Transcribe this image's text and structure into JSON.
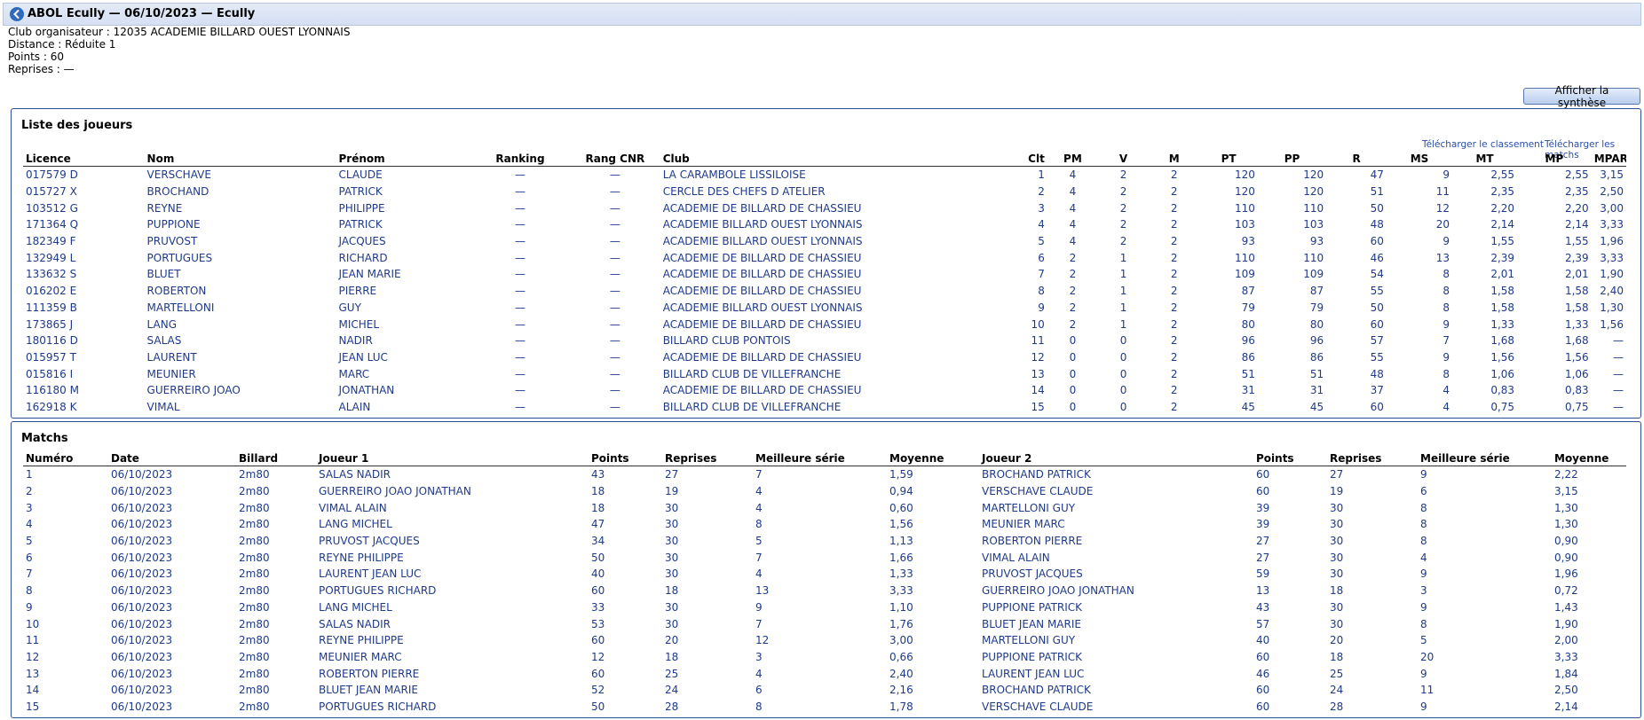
{
  "header": {
    "title": "ABOL Ecully — 06/10/2023 — Ecully",
    "back_icon": "arrow-left-circle-icon"
  },
  "info": {
    "club": "Club organisateur : 12035 ACADEMIE BILLARD OUEST LYONNAIS",
    "distance": "Distance : Réduite 1",
    "points": "Points : 60",
    "reprises": "Reprises : —"
  },
  "buttons": {
    "synthese": "Afficher la synthèse"
  },
  "players": {
    "title": "Liste des joueurs",
    "download_ranking": "Télécharger le classement",
    "download_matches": "Télécharger les matchs",
    "columns": [
      "Licence",
      "Nom",
      "Prénom",
      "Ranking",
      "Rang CNR",
      "Club",
      "Clt",
      "PM",
      "V",
      "M",
      "PT",
      "PP",
      "R",
      "MS",
      "MT",
      "MP",
      "MPART"
    ],
    "rows": [
      [
        "017579 D",
        "VERSCHAVE",
        "CLAUDE",
        "—",
        "—",
        "LA CARAMBOLE LISSILOISE",
        "1",
        "4",
        "2",
        "2",
        "120",
        "120",
        "47",
        "9",
        "2,55",
        "2,55",
        "3,15"
      ],
      [
        "015727 X",
        "BROCHAND",
        "PATRICK",
        "—",
        "—",
        "CERCLE DES CHEFS D ATELIER",
        "2",
        "4",
        "2",
        "2",
        "120",
        "120",
        "51",
        "11",
        "2,35",
        "2,35",
        "2,50"
      ],
      [
        "103512 G",
        "REYNE",
        "PHILIPPE",
        "—",
        "—",
        "ACADEMIE DE BILLARD DE CHASSIEU",
        "3",
        "4",
        "2",
        "2",
        "110",
        "110",
        "50",
        "12",
        "2,20",
        "2,20",
        "3,00"
      ],
      [
        "171364 Q",
        "PUPPIONE",
        "PATRICK",
        "—",
        "—",
        "ACADEMIE BILLARD OUEST LYONNAIS",
        "4",
        "4",
        "2",
        "2",
        "103",
        "103",
        "48",
        "20",
        "2,14",
        "2,14",
        "3,33"
      ],
      [
        "182349 F",
        "PRUVOST",
        "JACQUES",
        "—",
        "—",
        "ACADEMIE BILLARD OUEST LYONNAIS",
        "5",
        "4",
        "2",
        "2",
        "93",
        "93",
        "60",
        "9",
        "1,55",
        "1,55",
        "1,96"
      ],
      [
        "132949 L",
        "PORTUGUES",
        "RICHARD",
        "—",
        "—",
        "ACADEMIE DE BILLARD DE CHASSIEU",
        "6",
        "2",
        "1",
        "2",
        "110",
        "110",
        "46",
        "13",
        "2,39",
        "2,39",
        "3,33"
      ],
      [
        "133632 S",
        "BLUET",
        "JEAN MARIE",
        "—",
        "—",
        "ACADEMIE DE BILLARD DE CHASSIEU",
        "7",
        "2",
        "1",
        "2",
        "109",
        "109",
        "54",
        "8",
        "2,01",
        "2,01",
        "1,90"
      ],
      [
        "016202 E",
        "ROBERTON",
        "PIERRE",
        "—",
        "—",
        "ACADEMIE DE BILLARD DE CHASSIEU",
        "8",
        "2",
        "1",
        "2",
        "87",
        "87",
        "55",
        "8",
        "1,58",
        "1,58",
        "2,40"
      ],
      [
        "111359 B",
        "MARTELLONI",
        "GUY",
        "—",
        "—",
        "ACADEMIE BILLARD OUEST LYONNAIS",
        "9",
        "2",
        "1",
        "2",
        "79",
        "79",
        "50",
        "8",
        "1,58",
        "1,58",
        "1,30"
      ],
      [
        "173865 J",
        "LANG",
        "MICHEL",
        "—",
        "—",
        "ACADEMIE DE BILLARD DE CHASSIEU",
        "10",
        "2",
        "1",
        "2",
        "80",
        "80",
        "60",
        "9",
        "1,33",
        "1,33",
        "1,56"
      ],
      [
        "180116 D",
        "SALAS",
        "NADIR",
        "—",
        "—",
        "BILLARD CLUB PONTOIS",
        "11",
        "0",
        "0",
        "2",
        "96",
        "96",
        "57",
        "7",
        "1,68",
        "1,68",
        "—"
      ],
      [
        "015957 T",
        "LAURENT",
        "JEAN LUC",
        "—",
        "—",
        "ACADEMIE DE BILLARD DE CHASSIEU",
        "12",
        "0",
        "0",
        "2",
        "86",
        "86",
        "55",
        "9",
        "1,56",
        "1,56",
        "—"
      ],
      [
        "015816 I",
        "MEUNIER",
        "MARC",
        "—",
        "—",
        "BILLARD CLUB DE VILLEFRANCHE",
        "13",
        "0",
        "0",
        "2",
        "51",
        "51",
        "48",
        "8",
        "1,06",
        "1,06",
        "—"
      ],
      [
        "116180 M",
        "GUERREIRO JOAO",
        "JONATHAN",
        "—",
        "—",
        "ACADEMIE DE BILLARD DE CHASSIEU",
        "14",
        "0",
        "0",
        "2",
        "31",
        "31",
        "37",
        "4",
        "0,83",
        "0,83",
        "—"
      ],
      [
        "162918 K",
        "VIMAL",
        "ALAIN",
        "—",
        "—",
        "BILLARD CLUB DE VILLEFRANCHE",
        "15",
        "0",
        "0",
        "2",
        "45",
        "45",
        "60",
        "4",
        "0,75",
        "0,75",
        "—"
      ]
    ]
  },
  "matches": {
    "title": "Matchs",
    "columns": [
      "Numéro",
      "Date",
      "Billard",
      "Joueur 1",
      "Points",
      "Reprises",
      "Meilleure série",
      "Moyenne",
      "Joueur 2",
      "Points",
      "Reprises",
      "Meilleure série",
      "Moyenne"
    ],
    "rows": [
      [
        "1",
        "06/10/2023",
        "2m80",
        "SALAS NADIR",
        "43",
        "27",
        "7",
        "1,59",
        "BROCHAND PATRICK",
        "60",
        "27",
        "9",
        "2,22"
      ],
      [
        "2",
        "06/10/2023",
        "2m80",
        "GUERREIRO JOAO JONATHAN",
        "18",
        "19",
        "4",
        "0,94",
        "VERSCHAVE CLAUDE",
        "60",
        "19",
        "6",
        "3,15"
      ],
      [
        "3",
        "06/10/2023",
        "2m80",
        "VIMAL ALAIN",
        "18",
        "30",
        "4",
        "0,60",
        "MARTELLONI GUY",
        "39",
        "30",
        "8",
        "1,30"
      ],
      [
        "4",
        "06/10/2023",
        "2m80",
        "LANG MICHEL",
        "47",
        "30",
        "8",
        "1,56",
        "MEUNIER MARC",
        "39",
        "30",
        "8",
        "1,30"
      ],
      [
        "5",
        "06/10/2023",
        "2m80",
        "PRUVOST JACQUES",
        "34",
        "30",
        "5",
        "1,13",
        "ROBERTON PIERRE",
        "27",
        "30",
        "8",
        "0,90"
      ],
      [
        "6",
        "06/10/2023",
        "2m80",
        "REYNE PHILIPPE",
        "50",
        "30",
        "7",
        "1,66",
        "VIMAL ALAIN",
        "27",
        "30",
        "4",
        "0,90"
      ],
      [
        "7",
        "06/10/2023",
        "2m80",
        "LAURENT JEAN LUC",
        "40",
        "30",
        "4",
        "1,33",
        "PRUVOST JACQUES",
        "59",
        "30",
        "9",
        "1,96"
      ],
      [
        "8",
        "06/10/2023",
        "2m80",
        "PORTUGUES RICHARD",
        "60",
        "18",
        "13",
        "3,33",
        "GUERREIRO JOAO JONATHAN",
        "13",
        "18",
        "3",
        "0,72"
      ],
      [
        "9",
        "06/10/2023",
        "2m80",
        "LANG MICHEL",
        "33",
        "30",
        "9",
        "1,10",
        "PUPPIONE PATRICK",
        "43",
        "30",
        "9",
        "1,43"
      ],
      [
        "10",
        "06/10/2023",
        "2m80",
        "SALAS NADIR",
        "53",
        "30",
        "7",
        "1,76",
        "BLUET JEAN MARIE",
        "57",
        "30",
        "8",
        "1,90"
      ],
      [
        "11",
        "06/10/2023",
        "2m80",
        "REYNE PHILIPPE",
        "60",
        "20",
        "12",
        "3,00",
        "MARTELLONI GUY",
        "40",
        "20",
        "5",
        "2,00"
      ],
      [
        "12",
        "06/10/2023",
        "2m80",
        "MEUNIER MARC",
        "12",
        "18",
        "3",
        "0,66",
        "PUPPIONE PATRICK",
        "60",
        "18",
        "20",
        "3,33"
      ],
      [
        "13",
        "06/10/2023",
        "2m80",
        "ROBERTON PIERRE",
        "60",
        "25",
        "4",
        "2,40",
        "LAURENT JEAN LUC",
        "46",
        "25",
        "9",
        "1,84"
      ],
      [
        "14",
        "06/10/2023",
        "2m80",
        "BLUET JEAN MARIE",
        "52",
        "24",
        "6",
        "2,16",
        "BROCHAND PATRICK",
        "60",
        "24",
        "11",
        "2,50"
      ],
      [
        "15",
        "06/10/2023",
        "2m80",
        "PORTUGUES RICHARD",
        "50",
        "28",
        "8",
        "1,78",
        "VERSCHAVE CLAUDE",
        "60",
        "28",
        "9",
        "2,14"
      ]
    ]
  }
}
